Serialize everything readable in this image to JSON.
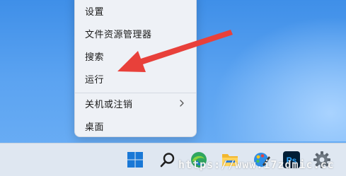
{
  "context_menu": {
    "items": [
      {
        "label": "设置"
      },
      {
        "label": "文件资源管理器"
      },
      {
        "label": "搜索"
      },
      {
        "label": "运行"
      },
      {
        "label": "关机或注销",
        "has_submenu": true
      },
      {
        "label": "桌面"
      }
    ]
  },
  "annotation": {
    "arrow_color": "#e8403a",
    "points_to": "运行"
  },
  "taskbar": {
    "icons": [
      {
        "name": "windows-start-icon"
      },
      {
        "name": "search-icon"
      },
      {
        "name": "edge-browser-icon"
      },
      {
        "name": "file-explorer-icon"
      },
      {
        "name": "paint-app-icon"
      },
      {
        "name": "photoshop-icon",
        "text": "Ps"
      },
      {
        "name": "settings-gear-icon"
      }
    ]
  },
  "watermark": {
    "text": "https://www.i7zdmic.cc"
  }
}
